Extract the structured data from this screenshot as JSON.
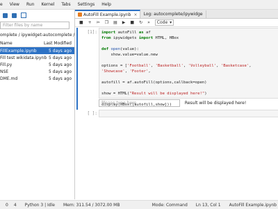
{
  "menu": [
    "e",
    "View",
    "Run",
    "Kernel",
    "Tabs",
    "Settings",
    "Help"
  ],
  "filebrowser": {
    "filter_placeholder": "Filter files by name",
    "breadcrumb": "omplete / ipywidget-autocomplete /",
    "header_name": "Name",
    "header_modified": "Last Modified",
    "files": [
      {
        "name": "FillExample.ipynb",
        "modified": "5 days ago",
        "selected": true
      },
      {
        "name": "Fill test wikidata.ipynb",
        "modified": "5 days ago"
      },
      {
        "name": "Fill.py",
        "modified": "5 days ago"
      },
      {
        "name": "NSE",
        "modified": "5 days ago"
      },
      {
        "name": "DME.md",
        "modified": "5 days ago"
      }
    ]
  },
  "tabs": [
    {
      "label": "AutoFill Example.ipynb",
      "close": "×"
    },
    {
      "label": "Log: autocomplete/ipywidge",
      "close": "×"
    }
  ],
  "notebook_toolbar": {
    "celltype": "Code",
    "icons": [
      "save",
      "add",
      "cut",
      "copy",
      "paste",
      "run",
      "stop",
      "restart",
      "fastforward"
    ]
  },
  "cell1": {
    "prompt": "[1]:",
    "lines": [
      "import autoFill as af",
      "from ipywidgets import HTML, HBox",
      "",
      "def open(value):",
      "    show.value=value.new",
      "",
      "options = ['Football', 'Basketball', 'Volleyball', 'Basketcase', 'Showcase', 'Footer',",
      "",
      "autofill = af.autoFill(options,callback=open)",
      "",
      "show = HTML(\"Result will be displayed here!\")",
      "",
      "display(HBox([autofill,show]))"
    ]
  },
  "output": {
    "input_placeholder": "Please type here...",
    "text": "Result will be displayed here!"
  },
  "cell2": {
    "prompt": "[ ]:"
  },
  "status": {
    "left1": "0",
    "left2": "4",
    "kernel": "Python 3 | Idle",
    "mem": "Mem: 311.54 / 3072.00 MB",
    "mode": "Mode: Command",
    "pos": "Ln 13, Col 1",
    "file": "AutoFill Example.ipynb"
  }
}
